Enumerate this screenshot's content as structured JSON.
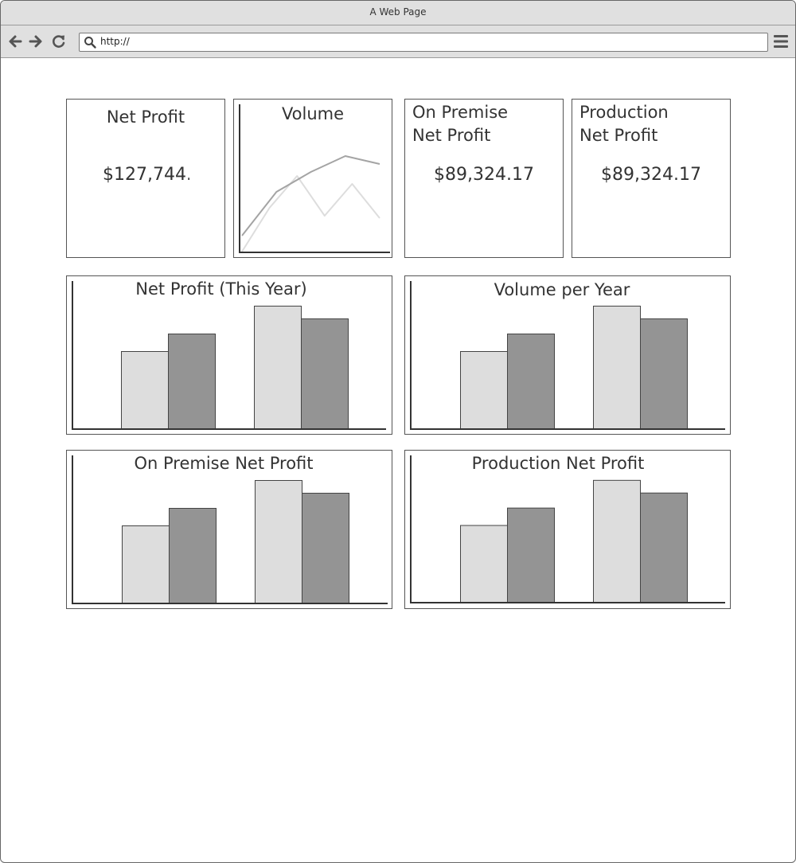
{
  "window": {
    "title": "A Web Page"
  },
  "toolbar": {
    "url": "http://"
  },
  "kpis": [
    {
      "title_lines": [
        "Net Profit"
      ],
      "value": "$127,744."
    },
    {
      "title_lines": [
        "Volume"
      ]
    },
    {
      "title_lines": [
        "On Premise",
        "Net Profit"
      ],
      "value": "$89,324.17"
    },
    {
      "title_lines": [
        "Production",
        "Net Profit"
      ],
      "value": "$89,324.17"
    }
  ],
  "colors": {
    "light_bar": "#dddddd",
    "dark_bar": "#949494",
    "axis": "#333333"
  },
  "chart_data": [
    {
      "type": "line",
      "title": "Volume",
      "series": [
        {
          "values": [
            20,
            75,
            100,
            120,
            110
          ]
        },
        {
          "values": [
            0,
            55,
            95,
            45,
            85,
            42
          ]
        }
      ],
      "ylim": [
        0,
        170
      ],
      "grid": false
    },
    {
      "type": "bar",
      "title": "Net Profit (This Year)",
      "series": [
        {
          "values": [
            97,
            154
          ]
        },
        {
          "values": [
            119,
            138
          ]
        }
      ],
      "ylim": [
        0,
        185
      ]
    },
    {
      "type": "bar",
      "title": "Volume per Year",
      "series": [
        {
          "values": [
            97,
            154
          ]
        },
        {
          "values": [
            119,
            138
          ]
        }
      ],
      "ylim": [
        0,
        185
      ]
    },
    {
      "type": "bar",
      "title": "On Premise Net Profit",
      "series": [
        {
          "values": [
            97,
            154
          ]
        },
        {
          "values": [
            119,
            138
          ]
        }
      ],
      "ylim": [
        0,
        185
      ]
    },
    {
      "type": "bar",
      "title": "Production Net Profit",
      "series": [
        {
          "values": [
            97,
            154
          ]
        },
        {
          "values": [
            119,
            138
          ]
        }
      ],
      "ylim": [
        0,
        185
      ]
    }
  ]
}
